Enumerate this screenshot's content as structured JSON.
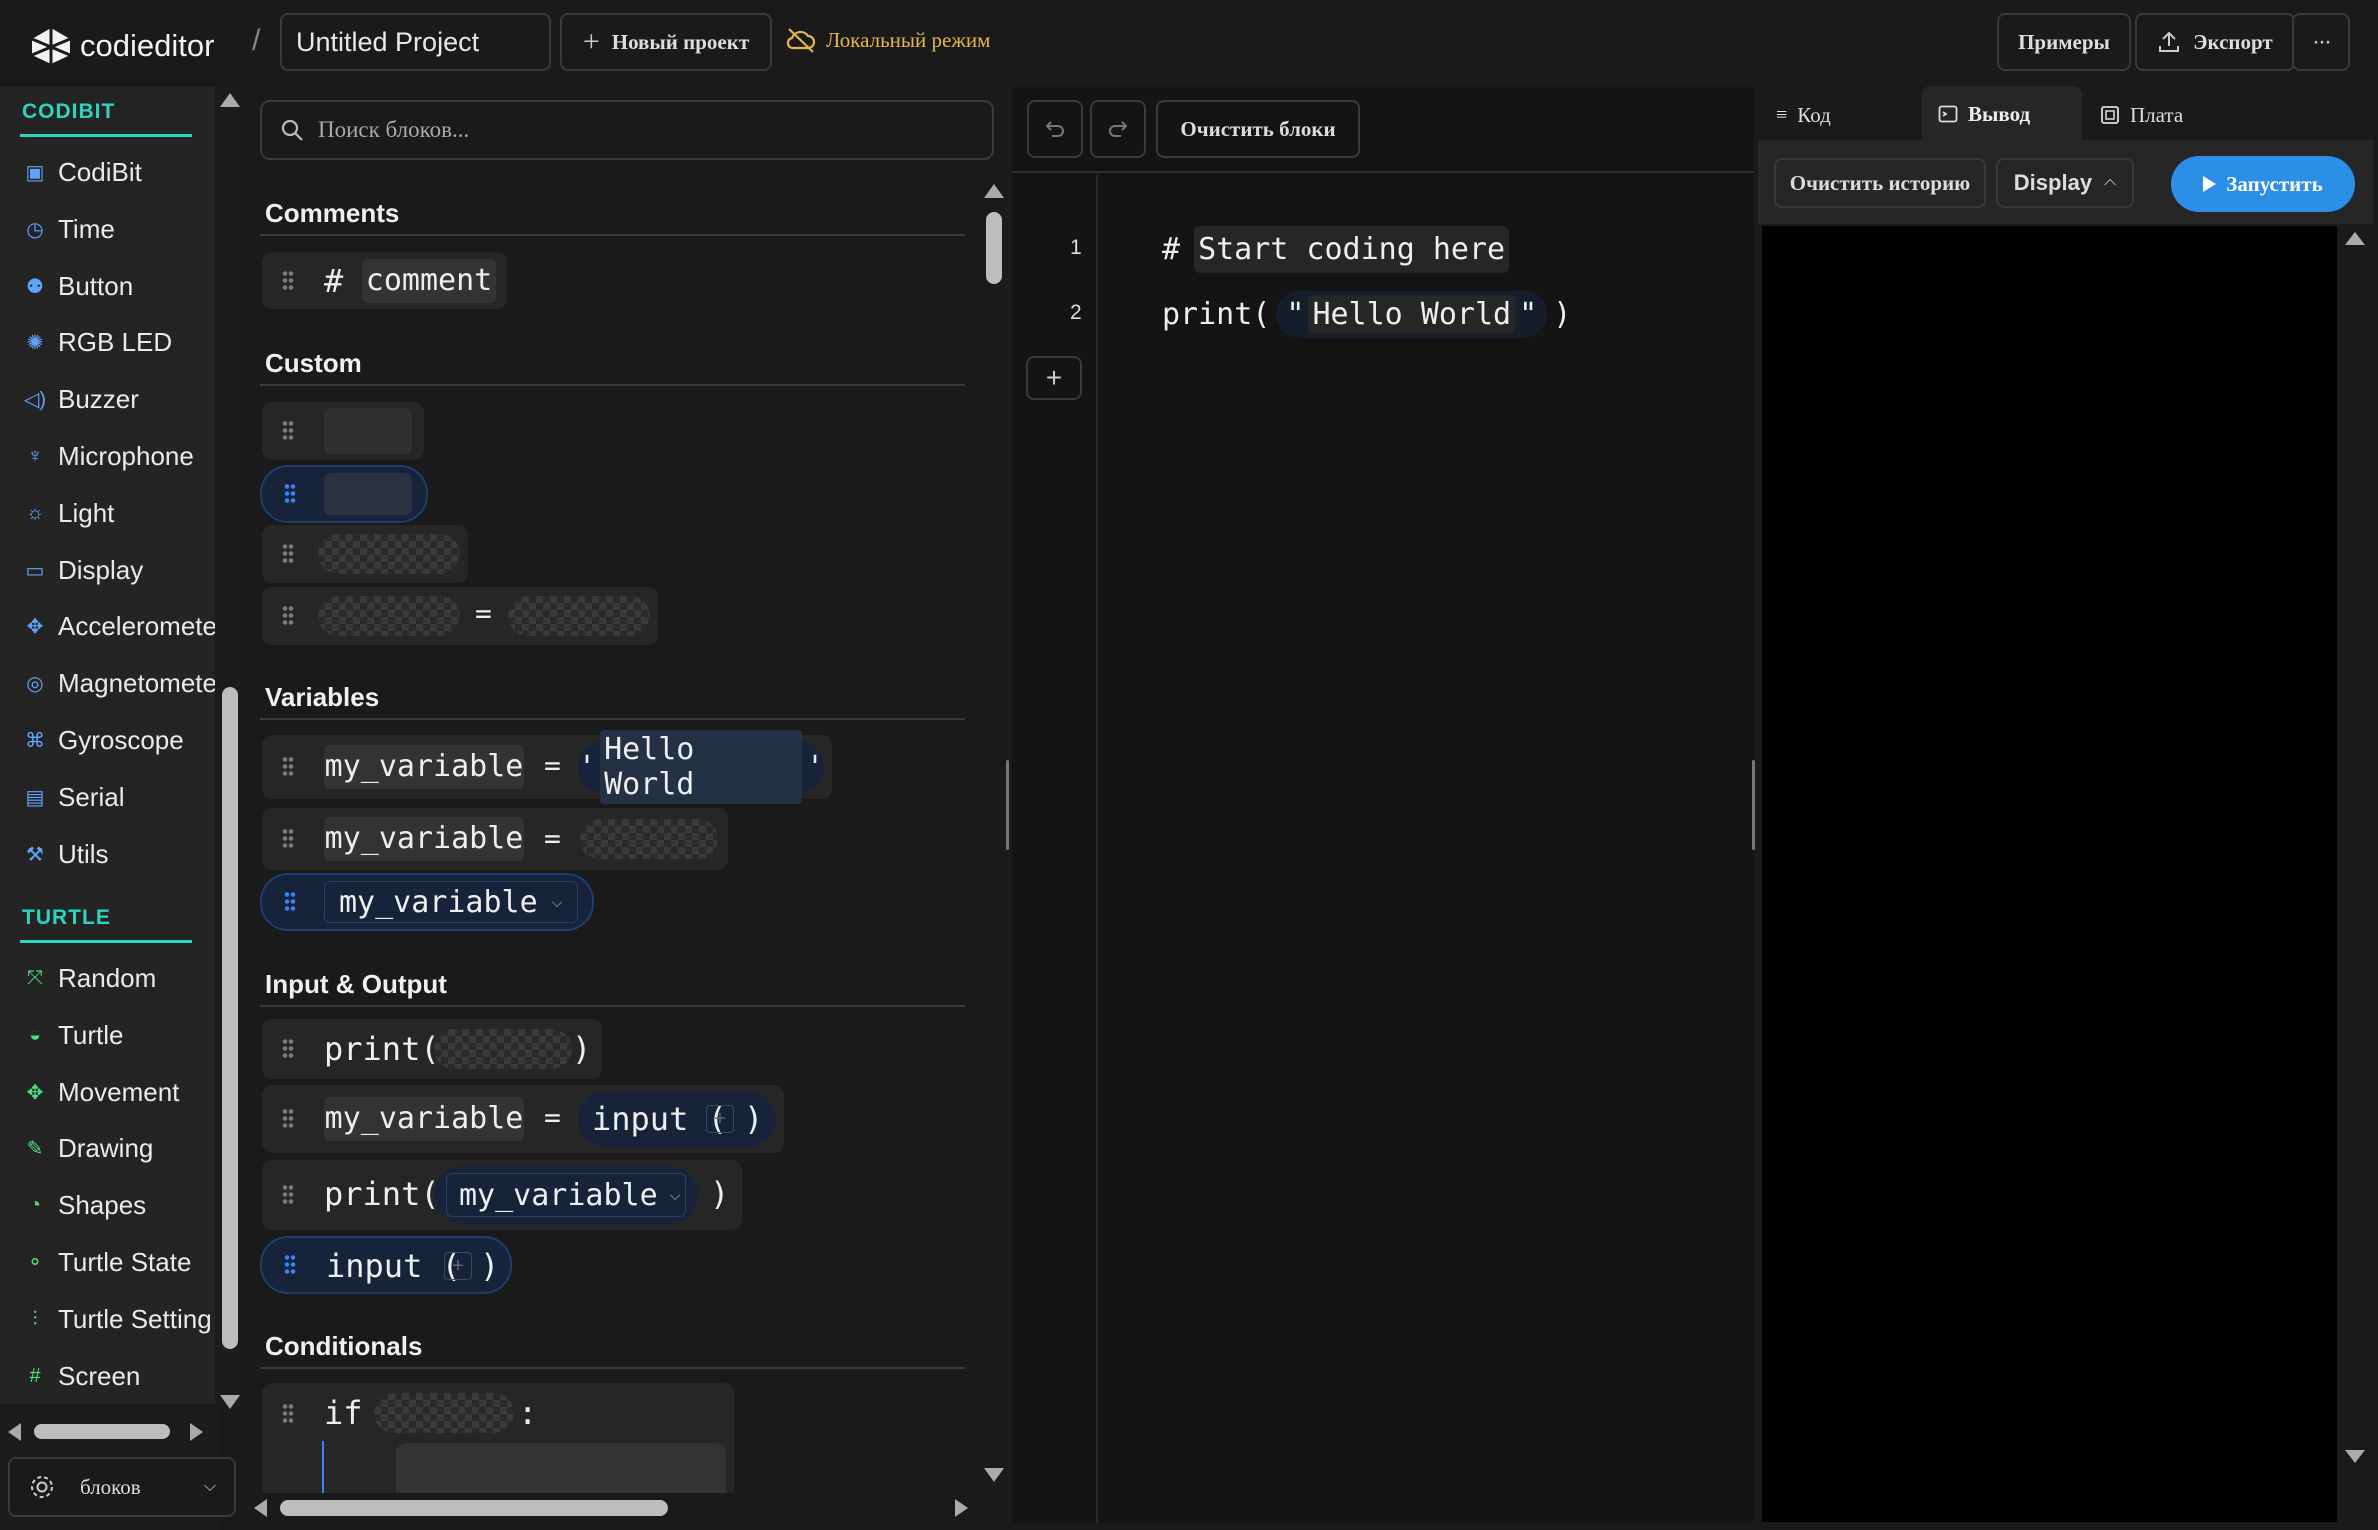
{
  "header": {
    "app_name": "codieditor",
    "separator": "/",
    "project_name": "Untitled Project",
    "new_project": "Новый проект",
    "local_mode": "Локальный режим",
    "examples": "Примеры",
    "export": "Экспорт",
    "more": "···"
  },
  "sidebar": {
    "groups": [
      {
        "title": "CODIBIT",
        "items": [
          {
            "label": "CodiBit",
            "icon": "board-icon"
          },
          {
            "label": "Time",
            "icon": "timer-icon"
          },
          {
            "label": "Button",
            "icon": "button-icon"
          },
          {
            "label": "RGB LED",
            "icon": "led-icon"
          },
          {
            "label": "Buzzer",
            "icon": "speaker-icon"
          },
          {
            "label": "Microphone",
            "icon": "microphone-icon"
          },
          {
            "label": "Light",
            "icon": "sun-icon"
          },
          {
            "label": "Display",
            "icon": "display-icon"
          },
          {
            "label": "Acceleromete",
            "icon": "move-icon"
          },
          {
            "label": "Magnetomete",
            "icon": "compass-icon"
          },
          {
            "label": "Gyroscope",
            "icon": "gyroscope-icon"
          },
          {
            "label": "Serial",
            "icon": "message-icon"
          },
          {
            "label": "Utils",
            "icon": "wrench-icon"
          }
        ]
      },
      {
        "title": "TURTLE",
        "items": [
          {
            "label": "Random",
            "icon": "shuffle-icon"
          },
          {
            "label": "Turtle",
            "icon": "turtle-icon"
          },
          {
            "label": "Movement",
            "icon": "move-icon"
          },
          {
            "label": "Drawing",
            "icon": "pen-icon"
          },
          {
            "label": "Shapes",
            "icon": "shapes-icon"
          },
          {
            "label": "Turtle State",
            "icon": "state-icon"
          },
          {
            "label": "Turtle Setting",
            "icon": "sliders-icon"
          },
          {
            "label": "Screen",
            "icon": "frame-icon"
          }
        ]
      }
    ],
    "footer_select": "блоков"
  },
  "palette": {
    "search_placeholder": "Поиск блоков...",
    "sections": {
      "comments": "Comments",
      "custom": "Custom",
      "variables": "Variables",
      "io": "Input & Output",
      "conditionals": "Conditionals"
    },
    "blocks": {
      "hash": "#",
      "comment": "comment",
      "eq": "=",
      "var": "my_variable",
      "q1": "'",
      "hello": "Hello World",
      "q2": "'",
      "print_open": "print(",
      "close": ")",
      "input_open": "input (",
      "plus": "+",
      "if_kw": "if",
      "colon": ":"
    }
  },
  "editor": {
    "clear_blocks": "Очистить блоки",
    "lines": [
      {
        "num": "1",
        "hash": "#",
        "comment": "Start coding here"
      },
      {
        "num": "2",
        "print": "print(",
        "q1": "\"",
        "str": "Hello World",
        "q2": "\"",
        "close": ")"
      }
    ],
    "add": "+"
  },
  "output": {
    "tabs": [
      "Код",
      "Вывод",
      "Плата"
    ],
    "active_tab": "Вывод",
    "clear_history": "Очистить историю",
    "display": "Display",
    "run": "Запустить"
  },
  "colors": {
    "accent_teal": "#2dd4bf",
    "run_blue": "#2b8fe8",
    "local_mode_amber": "#e6b84a",
    "selected_block": "#16233a"
  }
}
